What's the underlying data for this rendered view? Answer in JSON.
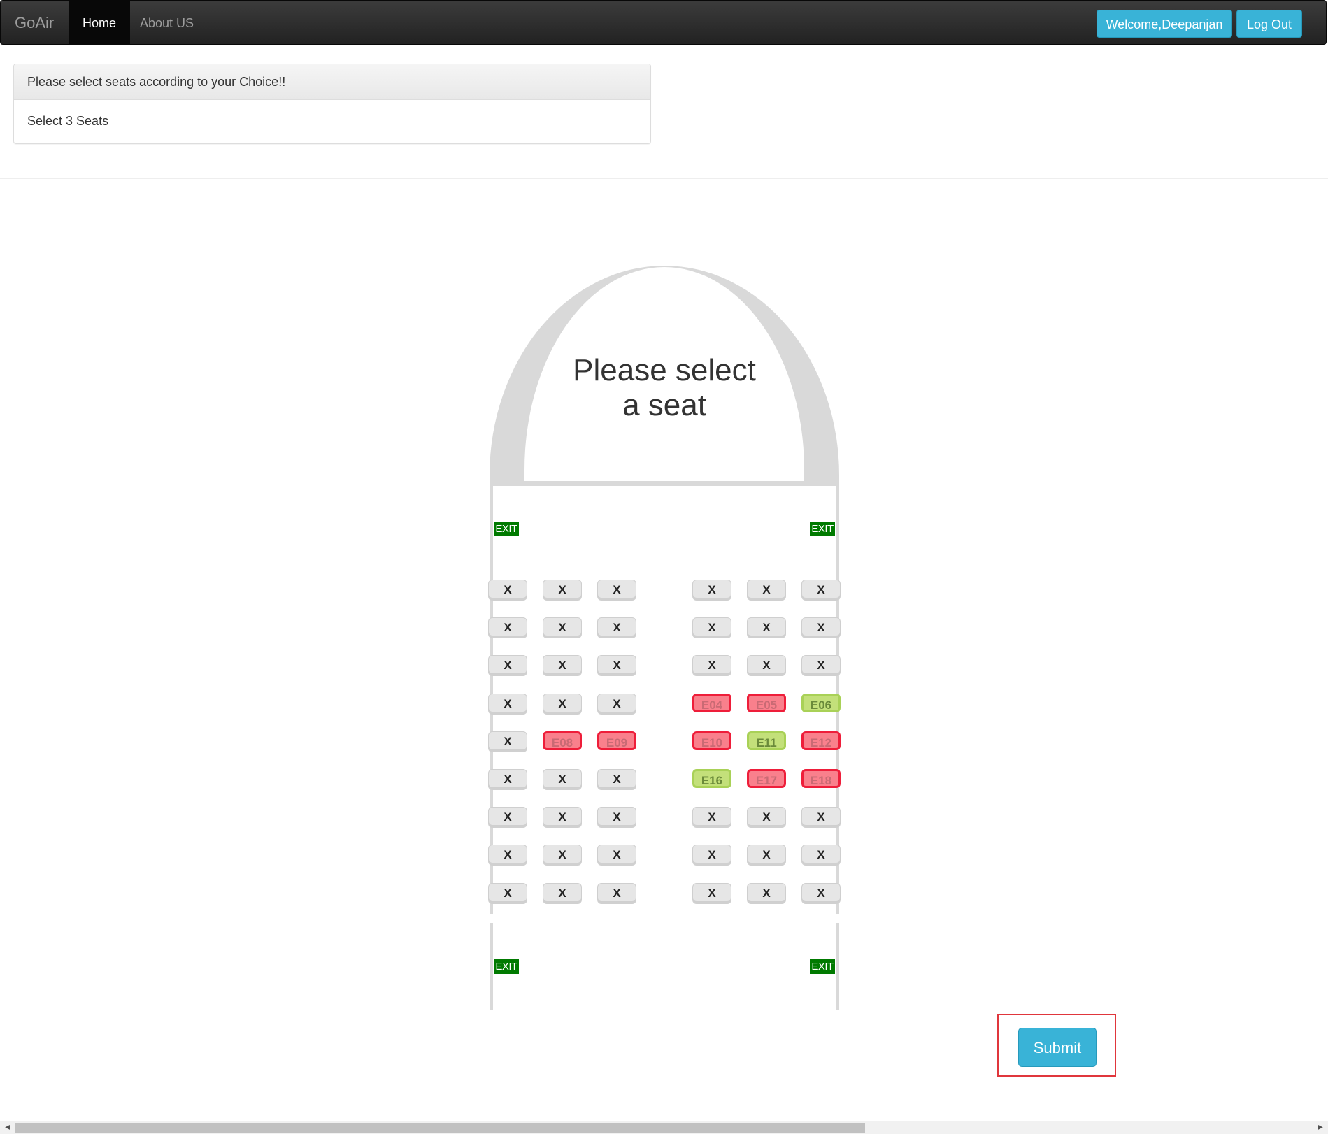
{
  "navbar": {
    "brand": "GoAir",
    "items": [
      {
        "label": "Home",
        "active": true
      },
      {
        "label": "About US",
        "active": false
      }
    ],
    "welcome_label": "Welcome,Deepanjan",
    "logout_label": "Log Out"
  },
  "panel": {
    "heading": "Please select seats according to your Choice!!",
    "body": "Select 3 Seats"
  },
  "plane": {
    "title_line1": "Please select",
    "title_line2": "a seat",
    "exit_label": "EXIT"
  },
  "seat_legend_colors": {
    "blocked": "#e6e6e6",
    "booked": "#ee1e3a",
    "available": "#a9d157"
  },
  "seat_rows": [
    [
      {
        "label": "X",
        "state": "blocked"
      },
      {
        "label": "X",
        "state": "blocked"
      },
      {
        "label": "X",
        "state": "blocked"
      },
      {
        "label": "X",
        "state": "blocked"
      },
      {
        "label": "X",
        "state": "blocked"
      },
      {
        "label": "X",
        "state": "blocked"
      }
    ],
    [
      {
        "label": "X",
        "state": "blocked"
      },
      {
        "label": "X",
        "state": "blocked"
      },
      {
        "label": "X",
        "state": "blocked"
      },
      {
        "label": "X",
        "state": "blocked"
      },
      {
        "label": "X",
        "state": "blocked"
      },
      {
        "label": "X",
        "state": "blocked"
      }
    ],
    [
      {
        "label": "X",
        "state": "blocked"
      },
      {
        "label": "X",
        "state": "blocked"
      },
      {
        "label": "X",
        "state": "blocked"
      },
      {
        "label": "X",
        "state": "blocked"
      },
      {
        "label": "X",
        "state": "blocked"
      },
      {
        "label": "X",
        "state": "blocked"
      }
    ],
    [
      {
        "label": "X",
        "state": "blocked"
      },
      {
        "label": "X",
        "state": "blocked"
      },
      {
        "label": "X",
        "state": "blocked"
      },
      {
        "label": "E04",
        "state": "booked"
      },
      {
        "label": "E05",
        "state": "booked"
      },
      {
        "label": "E06",
        "state": "available"
      }
    ],
    [
      {
        "label": "X",
        "state": "blocked"
      },
      {
        "label": "E08",
        "state": "booked"
      },
      {
        "label": "E09",
        "state": "booked"
      },
      {
        "label": "E10",
        "state": "booked"
      },
      {
        "label": "E11",
        "state": "available"
      },
      {
        "label": "E12",
        "state": "booked"
      }
    ],
    [
      {
        "label": "X",
        "state": "blocked"
      },
      {
        "label": "X",
        "state": "blocked"
      },
      {
        "label": "X",
        "state": "blocked"
      },
      {
        "label": "E16",
        "state": "available"
      },
      {
        "label": "E17",
        "state": "booked"
      },
      {
        "label": "E18",
        "state": "booked"
      }
    ],
    [
      {
        "label": "X",
        "state": "blocked"
      },
      {
        "label": "X",
        "state": "blocked"
      },
      {
        "label": "X",
        "state": "blocked"
      },
      {
        "label": "X",
        "state": "blocked"
      },
      {
        "label": "X",
        "state": "blocked"
      },
      {
        "label": "X",
        "state": "blocked"
      }
    ],
    [
      {
        "label": "X",
        "state": "blocked"
      },
      {
        "label": "X",
        "state": "blocked"
      },
      {
        "label": "X",
        "state": "blocked"
      },
      {
        "label": "X",
        "state": "blocked"
      },
      {
        "label": "X",
        "state": "blocked"
      },
      {
        "label": "X",
        "state": "blocked"
      }
    ],
    [
      {
        "label": "X",
        "state": "blocked"
      },
      {
        "label": "X",
        "state": "blocked"
      },
      {
        "label": "X",
        "state": "blocked"
      },
      {
        "label": "X",
        "state": "blocked"
      },
      {
        "label": "X",
        "state": "blocked"
      },
      {
        "label": "X",
        "state": "blocked"
      }
    ]
  ],
  "submit_label": "Submit"
}
